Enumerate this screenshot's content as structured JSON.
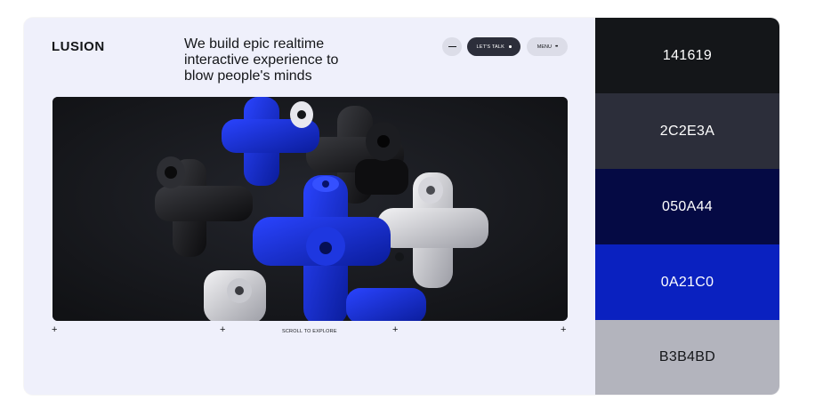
{
  "site": {
    "logo": "LUSION",
    "headline": [
      "We build epic realtime",
      "interactive experience to",
      "blow people's minds"
    ],
    "nav": {
      "talk_label": "LET'S TALK",
      "menu_label": "MENU"
    },
    "scroll_label": "SCROLL TO EXPLORE",
    "plus_glyph": "+"
  },
  "palette": {
    "swatches": [
      {
        "label": "141619",
        "color": "#141619",
        "text_color": "#ffffff"
      },
      {
        "label": "2C2E3A",
        "color": "#2c2e3a",
        "text_color": "#ffffff"
      },
      {
        "label": "050A44",
        "color": "#050a44",
        "text_color": "#ffffff"
      },
      {
        "label": "0A21C0",
        "color": "#0a21c0",
        "text_color": "#ffffff"
      },
      {
        "label": "B3B4BD",
        "color": "#b3b4bd",
        "text_color": "#141619"
      }
    ]
  },
  "colors": {
    "background": "#eff0fb",
    "accent": "#0a21c0"
  }
}
